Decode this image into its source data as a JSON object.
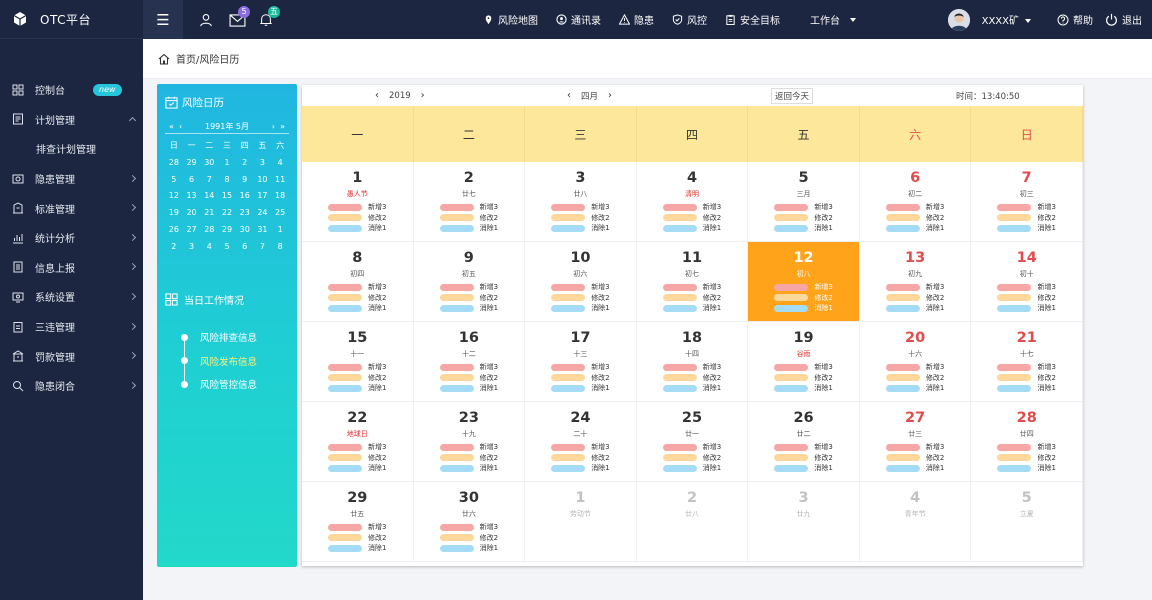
{
  "app": {
    "title": "OTC平台"
  },
  "sidebar": {
    "items": [
      {
        "label": "控制台",
        "icon": "dashboard-icon",
        "badge": "new"
      },
      {
        "label": "计划管理",
        "icon": "plan-icon",
        "open": true
      },
      {
        "label": "排查计划管理",
        "sub": true
      },
      {
        "label": "隐患管理",
        "icon": "hazard-icon"
      },
      {
        "label": "标准管理",
        "icon": "standard-icon"
      },
      {
        "label": "统计分析",
        "icon": "chart-icon"
      },
      {
        "label": "信息上报",
        "icon": "report-icon"
      },
      {
        "label": "系统设置",
        "icon": "settings-icon"
      },
      {
        "label": "三违管理",
        "icon": "violation-icon"
      },
      {
        "label": "罚款管理",
        "icon": "fine-icon"
      },
      {
        "label": "隐患闭合",
        "icon": "close-loop-icon"
      }
    ]
  },
  "topbar": {
    "mail_badge": "5",
    "bell_badge": "五",
    "menu": [
      "风险地图",
      "通讯录",
      "隐患",
      "风控",
      "安全目标",
      "工作台"
    ],
    "user": "XXXX矿",
    "help": "帮助",
    "logout": "退出"
  },
  "breadcrumb": "首页/风险日历",
  "left_panel": {
    "title": "风险日历",
    "mini_calendar": {
      "header": "1991年 5月",
      "weekdays": [
        "日",
        "一",
        "二",
        "三",
        "四",
        "五",
        "六"
      ],
      "days": [
        "28",
        "29",
        "30",
        "1",
        "2",
        "3",
        "4",
        "5",
        "6",
        "7",
        "8",
        "9",
        "10",
        "11",
        "12",
        "13",
        "14",
        "15",
        "16",
        "17",
        "18",
        "19",
        "20",
        "21",
        "22",
        "23",
        "24",
        "25",
        "26",
        "27",
        "28",
        "29",
        "30",
        "31",
        "1",
        "2",
        "3",
        "4",
        "5",
        "6",
        "7",
        "8"
      ],
      "selected": "14"
    },
    "work_title": "当日工作情况",
    "work_items": [
      "风险排查信息",
      "风险发布信息",
      "风险管控信息"
    ],
    "active_item": 1
  },
  "calendar": {
    "year": "2019",
    "month": "四月",
    "today_btn": "返回今天",
    "time": "时间：13:40:50",
    "weekdays": [
      "一",
      "二",
      "三",
      "四",
      "五",
      "六",
      "日"
    ],
    "tag_labels": [
      "新增3",
      "修改2",
      "消除1"
    ],
    "days": [
      {
        "n": "1",
        "s": "愚人节",
        "r": 1
      },
      {
        "n": "2",
        "s": "廿七"
      },
      {
        "n": "3",
        "s": "廿八"
      },
      {
        "n": "4",
        "s": "清明",
        "r": 1
      },
      {
        "n": "5",
        "s": "三月"
      },
      {
        "n": "6",
        "s": "初二"
      },
      {
        "n": "7",
        "s": "初三"
      },
      {
        "n": "8",
        "s": "初四"
      },
      {
        "n": "9",
        "s": "初五"
      },
      {
        "n": "10",
        "s": "初六"
      },
      {
        "n": "11",
        "s": "初七"
      },
      {
        "n": "12",
        "s": "初八",
        "hl": 1
      },
      {
        "n": "13",
        "s": "初九"
      },
      {
        "n": "14",
        "s": "初十"
      },
      {
        "n": "15",
        "s": "十一"
      },
      {
        "n": "16",
        "s": "十二"
      },
      {
        "n": "17",
        "s": "十三"
      },
      {
        "n": "18",
        "s": "十四"
      },
      {
        "n": "19",
        "s": "谷雨",
        "r": 1
      },
      {
        "n": "20",
        "s": "十六"
      },
      {
        "n": "21",
        "s": "十七"
      },
      {
        "n": "22",
        "s": "地球日",
        "r": 1
      },
      {
        "n": "23",
        "s": "十九"
      },
      {
        "n": "24",
        "s": "二十"
      },
      {
        "n": "25",
        "s": "廿一"
      },
      {
        "n": "26",
        "s": "廿二"
      },
      {
        "n": "27",
        "s": "廿三"
      },
      {
        "n": "28",
        "s": "廿四"
      },
      {
        "n": "29",
        "s": "廿五"
      },
      {
        "n": "30",
        "s": "廿六"
      },
      {
        "n": "1",
        "s": "劳动节",
        "d": 1
      },
      {
        "n": "2",
        "s": "廿八",
        "d": 1
      },
      {
        "n": "3",
        "s": "廿九",
        "d": 1
      },
      {
        "n": "4",
        "s": "青年节",
        "d": 1
      },
      {
        "n": "5",
        "s": "立夏",
        "d": 1
      }
    ]
  }
}
